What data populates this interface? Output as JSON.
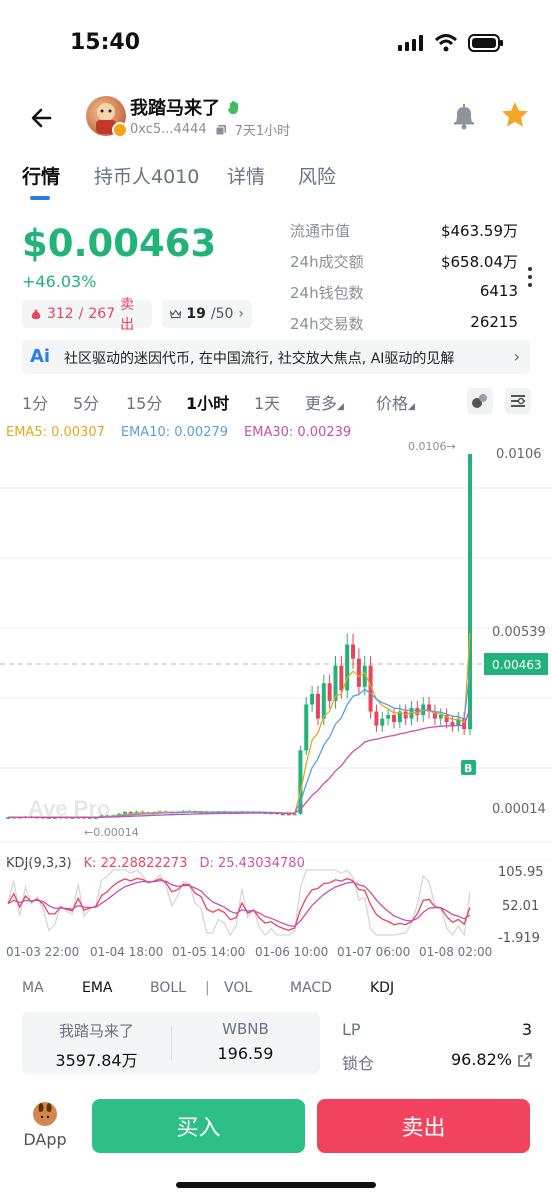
{
  "status_bar": {
    "time": "15:40"
  },
  "header": {
    "token_name": "我踏马来了",
    "address": "0xc5...4444",
    "age": "7天1小时"
  },
  "tabs": [
    {
      "label": "行情",
      "active": true
    },
    {
      "label": "持币人4010",
      "active": false
    },
    {
      "label": "详情",
      "active": false
    },
    {
      "label": "风险",
      "active": false
    }
  ],
  "price": {
    "value": "$0.00463",
    "change": "+46.03%",
    "buyers": "312",
    "sellers": "267",
    "sell_label": "卖出",
    "rank": "19",
    "rank_total": "/50"
  },
  "stats": [
    {
      "label": "流通市值",
      "value": "$463.59万"
    },
    {
      "label": "24h成交额",
      "value": "$658.04万"
    },
    {
      "label": "24h钱包数",
      "value": "6413"
    },
    {
      "label": "24h交易数",
      "value": "26215"
    }
  ],
  "ai_summary": {
    "icon": "Ai",
    "text": "社区驱动的迷因代币, 在中国流行, 社交放大焦点, AI驱动的见解"
  },
  "intervals": [
    {
      "label": "1分",
      "active": false
    },
    {
      "label": "5分",
      "active": false
    },
    {
      "label": "15分",
      "active": false
    },
    {
      "label": "1小时",
      "active": true
    },
    {
      "label": "1天",
      "active": false
    },
    {
      "label": "更多",
      "active": false,
      "caret": true
    },
    {
      "label": "价格",
      "active": false,
      "caret": true
    }
  ],
  "ema_legend": {
    "ema5": "EMA5: 0.00307",
    "ema10": "EMA10: 0.00279",
    "ema30": "EMA30: 0.00239"
  },
  "colors": {
    "up": "#21b37a",
    "down": "#e8445a",
    "ema5": "#e6a823",
    "ema10": "#5aa0d8",
    "ema30": "#c94fa8",
    "accent": "#2b7de9"
  },
  "chart_data": {
    "type": "candlestick",
    "y_ticks": [
      "0.0106",
      "0.00539",
      "0.00014"
    ],
    "current_price_tag": "0.00463",
    "high_marker": "0.0106→",
    "low_marker": "←0.00014",
    "watermark": "Ave Pro",
    "last_candle_label": "B",
    "x_labels": [
      "01-03 22:00",
      "01-04 18:00",
      "01-05 14:00",
      "01-06 10:00",
      "01-07 06:00",
      "01-08 02:00"
    ],
    "close_series": [
      0.0003,
      0.00031,
      0.00029,
      0.00032,
      0.0003,
      0.00031,
      0.0003,
      0.00029,
      0.0003,
      0.00031,
      0.0003,
      0.0003,
      0.00031,
      0.00029,
      0.0003,
      0.0003,
      0.00035,
      0.00034,
      0.00036,
      0.0004,
      0.00045,
      0.00042,
      0.00046,
      0.00044,
      0.00043,
      0.00045,
      0.00047,
      0.00045,
      0.00044,
      0.00046,
      0.00048,
      0.00047,
      0.00045,
      0.00046,
      0.00044,
      0.00045,
      0.00046,
      0.00045,
      0.00044,
      0.00045,
      0.00046,
      0.00044,
      0.00045,
      0.00044,
      0.00042,
      0.00043,
      0.0004,
      0.0004,
      0.00039,
      0.0004,
      0.0022,
      0.0035,
      0.0038,
      0.0031,
      0.0041,
      0.0036,
      0.0046,
      0.0039,
      0.0052,
      0.0048,
      0.004,
      0.0046,
      0.0033,
      0.0029,
      0.0031,
      0.0032,
      0.003,
      0.0033,
      0.0031,
      0.0034,
      0.0032,
      0.0035,
      0.0033,
      0.0031,
      0.0032,
      0.003,
      0.0029,
      0.0031,
      0.0028,
      0.0106
    ],
    "kdj": {
      "label": "KDJ(9,3,3)",
      "k": "K: 22.28822273",
      "d": "D: 25.43034780",
      "y_ticks": [
        "105.95",
        "52.01",
        "-1.919"
      ]
    }
  },
  "indicators": [
    {
      "label": "MA",
      "active": false
    },
    {
      "label": "EMA",
      "active": true
    },
    {
      "label": "BOLL",
      "active": false
    },
    {
      "label": "VOL",
      "active": false
    },
    {
      "label": "MACD",
      "active": false
    },
    {
      "label": "KDJ",
      "active": true
    }
  ],
  "pool": {
    "token_label": "我踏马来了",
    "token_amount": "3597.84万",
    "base_label": "WBNB",
    "base_amount": "196.59"
  },
  "lp": {
    "lp_label": "LP",
    "lp_value": "3",
    "lock_label": "锁仓",
    "lock_value": "96.82%"
  },
  "bottom": {
    "dapp_label": "DApp",
    "buy_label": "买入",
    "sell_label": "卖出"
  }
}
